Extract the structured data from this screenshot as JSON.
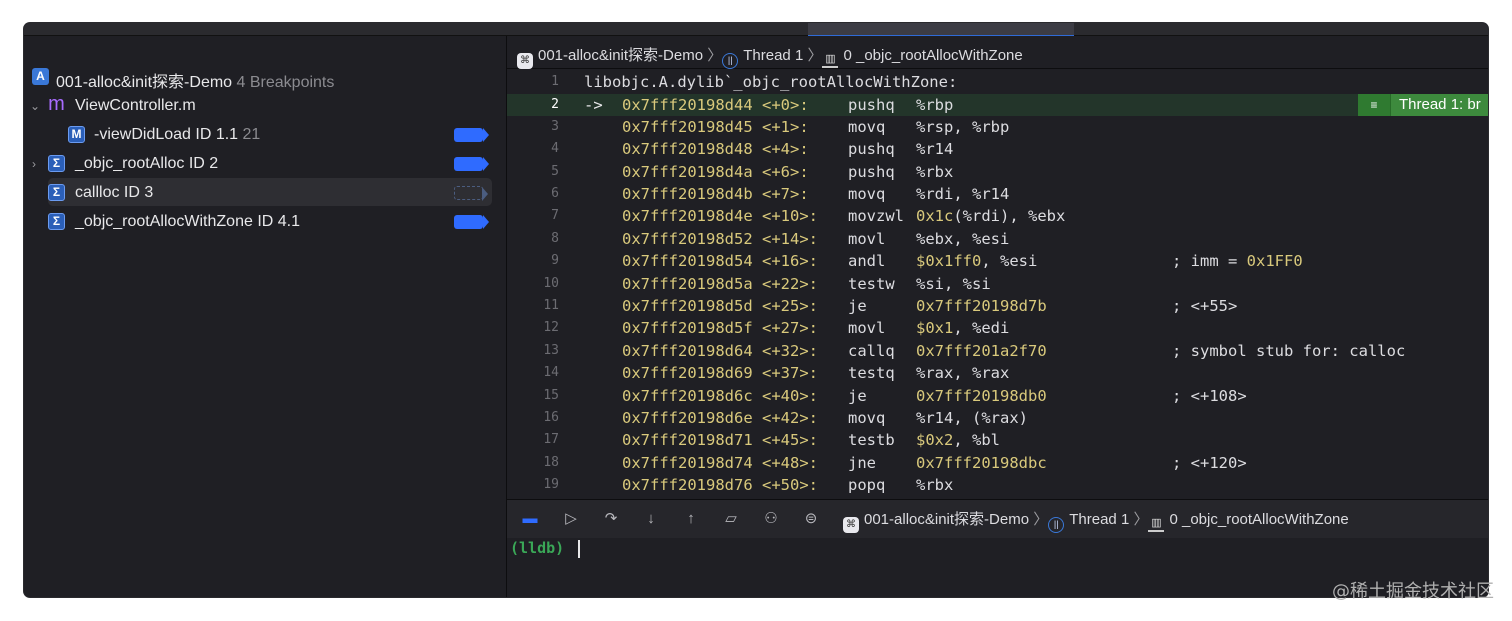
{
  "navigator": {
    "project": {
      "name": "001-alloc&init探索-Demo",
      "count": "4 Breakpoints"
    },
    "file": {
      "name": "ViewController.m"
    },
    "items": [
      {
        "label": "-viewDidLoad  ID 1.1",
        "line": "21"
      },
      {
        "label": "_objc_rootAlloc ID 2",
        "line": ""
      },
      {
        "label": "callloc ID 3",
        "line": ""
      },
      {
        "label": "_objc_rootAllocWithZone  ID 4.1",
        "line": ""
      }
    ]
  },
  "jumpbar": {
    "target": "001-alloc&init探索-Demo",
    "thread": "Thread 1",
    "frame": "0 _objc_rootAllocWithZone"
  },
  "disasm": {
    "header": "libobjc.A.dylib`_objc_rootAllocWithZone:",
    "current_arrow": "->",
    "thread_badge": "Thread 1: br",
    "lines": [
      {
        "n": "1"
      },
      {
        "n": "2",
        "addr": "0x7fff20198d44",
        "off": "<+0>:",
        "mn": "pushq",
        "ops": "%rbp"
      },
      {
        "n": "3",
        "addr": "0x7fff20198d45",
        "off": "<+1>:",
        "mn": "movq",
        "ops": "%rsp, %rbp"
      },
      {
        "n": "4",
        "addr": "0x7fff20198d48",
        "off": "<+4>:",
        "mn": "pushq",
        "ops": "%r14"
      },
      {
        "n": "5",
        "addr": "0x7fff20198d4a",
        "off": "<+6>:",
        "mn": "pushq",
        "ops": "%rbx"
      },
      {
        "n": "6",
        "addr": "0x7fff20198d4b",
        "off": "<+7>:",
        "mn": "movq",
        "ops": "%rdi, %r14"
      },
      {
        "n": "7",
        "addr": "0x7fff20198d4e",
        "off": "<+10>:",
        "mn": "movzwl",
        "ops_y": "0x1c",
        "ops": "(%rdi), %ebx"
      },
      {
        "n": "8",
        "addr": "0x7fff20198d52",
        "off": "<+14>:",
        "mn": "movl",
        "ops": "%ebx, %esi"
      },
      {
        "n": "9",
        "addr": "0x7fff20198d54",
        "off": "<+16>:",
        "mn": "andl",
        "ops_y": "$0x1ff0",
        "ops": ", %esi",
        "cm": "; imm = ",
        "cm_y": "0x1FF0"
      },
      {
        "n": "10",
        "addr": "0x7fff20198d5a",
        "off": "<+22>:",
        "mn": "testw",
        "ops": "%si, %si"
      },
      {
        "n": "11",
        "addr": "0x7fff20198d5d",
        "off": "<+25>:",
        "mn": "je",
        "ops_y": "0x7fff20198d7b",
        "ops": "",
        "cm": "; <+55>"
      },
      {
        "n": "12",
        "addr": "0x7fff20198d5f",
        "off": "<+27>:",
        "mn": "movl",
        "ops_y": "$0x1",
        "ops": ", %edi"
      },
      {
        "n": "13",
        "addr": "0x7fff20198d64",
        "off": "<+32>:",
        "mn": "callq",
        "ops_y": "0x7fff201a2f70",
        "ops": "",
        "cm": "; symbol stub for: calloc"
      },
      {
        "n": "14",
        "addr": "0x7fff20198d69",
        "off": "<+37>:",
        "mn": "testq",
        "ops": "%rax, %rax"
      },
      {
        "n": "15",
        "addr": "0x7fff20198d6c",
        "off": "<+40>:",
        "mn": "je",
        "ops_y": "0x7fff20198db0",
        "ops": "",
        "cm": "; <+108>"
      },
      {
        "n": "16",
        "addr": "0x7fff20198d6e",
        "off": "<+42>:",
        "mn": "movq",
        "ops": "%r14, (%rax)"
      },
      {
        "n": "17",
        "addr": "0x7fff20198d71",
        "off": "<+45>:",
        "mn": "testb",
        "ops_y": "$0x2",
        "ops": ", %bl"
      },
      {
        "n": "18",
        "addr": "0x7fff20198d74",
        "off": "<+48>:",
        "mn": "jne",
        "ops_y": "0x7fff20198dbc",
        "ops": "",
        "cm": "; <+120>"
      },
      {
        "n": "19",
        "addr": "0x7fff20198d76",
        "off": "<+50>:",
        "mn": "popq",
        "ops": "%rbx"
      }
    ]
  },
  "debugbar": {
    "target": "001-alloc&init探索-Demo",
    "thread": "Thread 1",
    "frame": "0 _objc_rootAllocWithZone"
  },
  "console": {
    "prompt": "(lldb)"
  },
  "watermark": "@稀土掘金技术社区"
}
